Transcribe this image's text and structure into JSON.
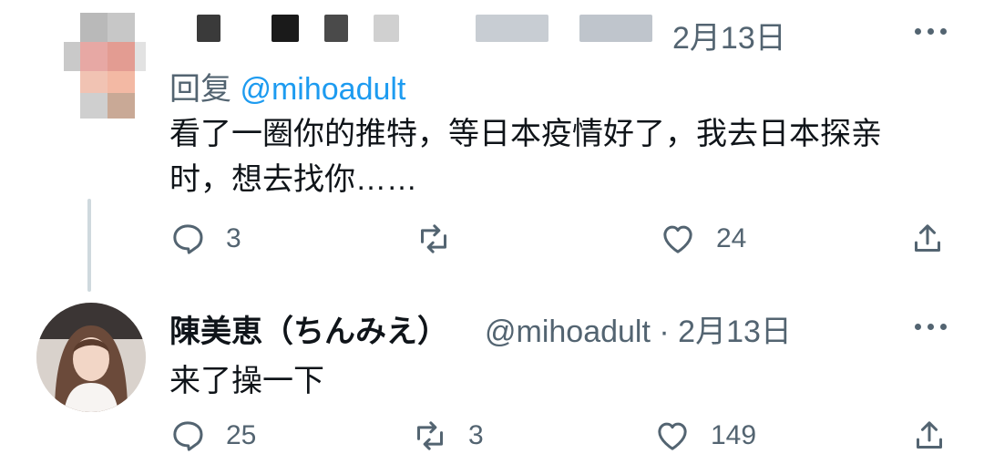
{
  "tweet1": {
    "date": "2月13日",
    "reply_prefix": "回复",
    "reply_mention": "@mihoadult",
    "text_line1": "看了一圈你的推特，等日本疫情好了，我去日本探亲",
    "text_line2": "时，想去找你……",
    "replies": "3",
    "likes": "24"
  },
  "tweet2": {
    "display_name": "陳美恵（ちんみえ）",
    "handle": "@mihoadult",
    "date": "2月13日",
    "text": "来了操一下",
    "replies": "25",
    "retweets": "3",
    "likes": "149"
  },
  "icons": [
    "reply-icon",
    "retweet-icon",
    "like-icon",
    "share-icon",
    "more-icon"
  ],
  "colors": {
    "accent": "#1d9bf0",
    "muted": "#536471",
    "text": "#0f1419",
    "line": "#cfd9de"
  }
}
